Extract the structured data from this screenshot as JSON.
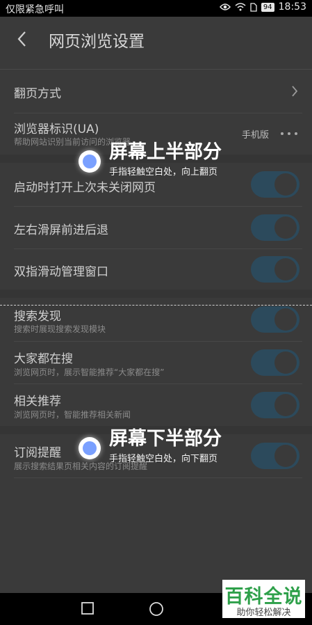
{
  "status": {
    "carrier": "仅限紧急呼叫",
    "battery": "94",
    "time": "18:53"
  },
  "header": {
    "title": "网页浏览设置"
  },
  "settings": {
    "page_turn": {
      "title": "翻页方式"
    },
    "ua": {
      "title": "浏览器标识(UA)",
      "subtitle": "帮助网站识别当前访问的浏览器",
      "value": "手机版"
    },
    "restore_tabs": {
      "title": "启动时打开上次未关闭网页",
      "on": true
    },
    "swipe_nav": {
      "title": "左右滑屏前进后退",
      "on": true
    },
    "two_finger": {
      "title": "双指滑动管理窗口",
      "on": true
    },
    "search_discover": {
      "title": "搜索发现",
      "subtitle": "搜索时展现搜索发现模块",
      "on": true
    },
    "everyone_search": {
      "title": "大家都在搜",
      "subtitle": "浏览网页时，展示智能推荐“大家都在搜”",
      "on": true
    },
    "related": {
      "title": "相关推荐",
      "subtitle": "浏览网页时，智能推荐相关新闻",
      "on": true
    },
    "subscribe": {
      "title": "订阅提醒",
      "subtitle": "展示搜索结果页相关内容的订阅提醒",
      "on": true
    }
  },
  "overlay": {
    "top_title": "屏幕上半部分",
    "top_sub": "手指轻触空白处，向上翻页",
    "bottom_title": "屏幕下半部分",
    "bottom_sub": "手指轻触空白处，向下翻页"
  },
  "watermark": {
    "main": "百科全说",
    "sub": "助你轻松解决"
  },
  "colors": {
    "toggle_on": "#2c4a5c",
    "hint_dot": "#7aa0ff",
    "brand_green": "#2ea04a"
  }
}
